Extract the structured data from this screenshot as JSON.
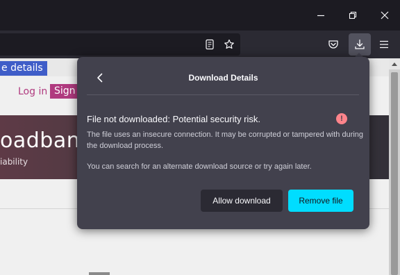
{
  "window": {
    "controls": [
      {
        "name": "minimize-button",
        "icon": "minimize-icon"
      },
      {
        "name": "restore-button",
        "icon": "restore-icon"
      },
      {
        "name": "close-button",
        "icon": "close-icon"
      }
    ]
  },
  "toolbar": {
    "icons": [
      "reader-view-icon",
      "bookmark-star-icon",
      "pocket-icon",
      "downloads-icon",
      "menu-icon"
    ],
    "downloads_active": true
  },
  "page": {
    "details_tag": "e details",
    "login_link": "Log in",
    "signup_button": "Sign u",
    "hero_title": "oadband",
    "hero_subtitle": "iability"
  },
  "download_panel": {
    "title": "Download Details",
    "back_icon": "chevron-left-icon",
    "warning_title": "File not downloaded: Potential security risk.",
    "warning_icon": "!",
    "warning_description": "The file uses an insecure connection. It may be corrupted or tampered with during the download process.",
    "hint": "You can search for an alternate download source or try again later.",
    "allow_button": "Allow download",
    "remove_button": "Remove file"
  },
  "colors": {
    "panel_bg": "#42414d",
    "primary_button": "#00ddff",
    "warning_icon": "#ff848b",
    "titlebar": "#1c1b22",
    "toolbar": "#2b2a33",
    "page_accent": "#b03a7f"
  }
}
